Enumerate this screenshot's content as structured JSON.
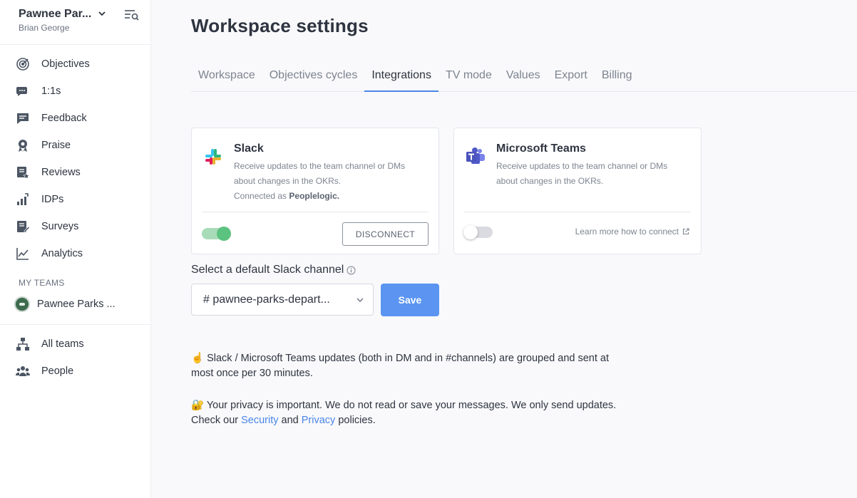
{
  "sidebar": {
    "workspace_name": "Pawnee Par...",
    "user_name": "Brian George",
    "nav": [
      {
        "label": "Objectives",
        "icon": "target-icon"
      },
      {
        "label": "1:1s",
        "icon": "chat-bubbles-icon"
      },
      {
        "label": "Feedback",
        "icon": "feedback-icon"
      },
      {
        "label": "Praise",
        "icon": "award-icon"
      },
      {
        "label": "Reviews",
        "icon": "review-icon"
      },
      {
        "label": "IDPs",
        "icon": "growth-chart-icon"
      },
      {
        "label": "Surveys",
        "icon": "survey-icon"
      },
      {
        "label": "Analytics",
        "icon": "line-chart-icon"
      }
    ],
    "my_teams_title": "MY TEAMS",
    "team_name": "Pawnee Parks ...",
    "bottom_nav": [
      {
        "label": "All teams",
        "icon": "org-chart-icon"
      },
      {
        "label": "People",
        "icon": "people-icon"
      }
    ]
  },
  "main": {
    "title": "Workspace settings",
    "tabs": [
      "Workspace",
      "Objectives cycles",
      "Integrations",
      "TV mode",
      "Values",
      "Export",
      "Billing"
    ],
    "active_tab": "Integrations",
    "slack": {
      "title": "Slack",
      "desc_line1": "Receive updates to the team channel or DMs about changes in the OKRs.",
      "connected_prefix": "Connected as ",
      "connected_name": "Peoplelogic.",
      "toggle_on": true,
      "disconnect_label": "DISCONNECT"
    },
    "teams": {
      "title": "Microsoft Teams",
      "desc": "Receive updates to the team channel or DMs about changes in the OKRs.",
      "toggle_on": false,
      "learn_more": "Learn more how to connect"
    },
    "channel_label": "Select a default Slack channel",
    "channel_value": "# pawnee-parks-depart...",
    "save_label": "Save",
    "note1": "☝️ Slack / Microsoft Teams updates (both in DM and in #channels) are grouped and sent at most once per 30 minutes.",
    "note2_text": "🔐 Your privacy is important. We do not read or save your messages. We only send updates.",
    "note2_check": "Check our ",
    "security_link": "Security",
    "and_text": " and ",
    "privacy_link": "Privacy",
    "policies_text": " policies."
  },
  "colors": {
    "accent": "#4a86e8",
    "save_button": "#5b95f1",
    "toggle_on": "#5cc27f"
  }
}
